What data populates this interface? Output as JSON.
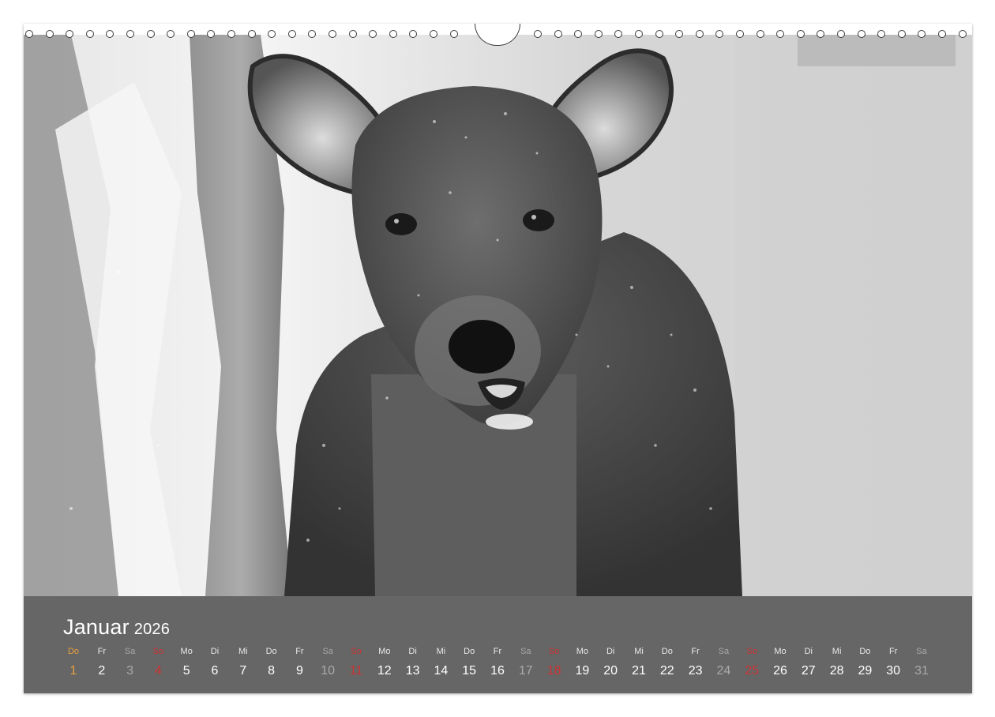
{
  "calendar": {
    "month": "Januar",
    "year": "2026",
    "days": [
      {
        "dow": "Do",
        "num": "1",
        "kind": "holiday"
      },
      {
        "dow": "Fr",
        "num": "2",
        "kind": "weekday"
      },
      {
        "dow": "Sa",
        "num": "3",
        "kind": "sat"
      },
      {
        "dow": "So",
        "num": "4",
        "kind": "sun"
      },
      {
        "dow": "Mo",
        "num": "5",
        "kind": "weekday"
      },
      {
        "dow": "Di",
        "num": "6",
        "kind": "weekday"
      },
      {
        "dow": "Mi",
        "num": "7",
        "kind": "weekday"
      },
      {
        "dow": "Do",
        "num": "8",
        "kind": "weekday"
      },
      {
        "dow": "Fr",
        "num": "9",
        "kind": "weekday"
      },
      {
        "dow": "Sa",
        "num": "10",
        "kind": "sat"
      },
      {
        "dow": "So",
        "num": "11",
        "kind": "sun"
      },
      {
        "dow": "Mo",
        "num": "12",
        "kind": "weekday"
      },
      {
        "dow": "Di",
        "num": "13",
        "kind": "weekday"
      },
      {
        "dow": "Mi",
        "num": "14",
        "kind": "weekday"
      },
      {
        "dow": "Do",
        "num": "15",
        "kind": "weekday"
      },
      {
        "dow": "Fr",
        "num": "16",
        "kind": "weekday"
      },
      {
        "dow": "Sa",
        "num": "17",
        "kind": "sat"
      },
      {
        "dow": "So",
        "num": "18",
        "kind": "sun"
      },
      {
        "dow": "Mo",
        "num": "19",
        "kind": "weekday"
      },
      {
        "dow": "Di",
        "num": "20",
        "kind": "weekday"
      },
      {
        "dow": "Mi",
        "num": "21",
        "kind": "weekday"
      },
      {
        "dow": "Do",
        "num": "22",
        "kind": "weekday"
      },
      {
        "dow": "Fr",
        "num": "23",
        "kind": "weekday"
      },
      {
        "dow": "Sa",
        "num": "24",
        "kind": "sat"
      },
      {
        "dow": "So",
        "num": "25",
        "kind": "sun"
      },
      {
        "dow": "Mo",
        "num": "26",
        "kind": "weekday"
      },
      {
        "dow": "Di",
        "num": "27",
        "kind": "weekday"
      },
      {
        "dow": "Mi",
        "num": "28",
        "kind": "weekday"
      },
      {
        "dow": "Do",
        "num": "29",
        "kind": "weekday"
      },
      {
        "dow": "Fr",
        "num": "30",
        "kind": "weekday"
      },
      {
        "dow": "Sa",
        "num": "31",
        "kind": "sat"
      }
    ]
  },
  "colors": {
    "calendar_bar": "#666666",
    "sunday": "#cc3232",
    "saturday": "#a9a9a9",
    "holiday": "#e6a23c",
    "text": "#ffffff"
  },
  "photo": {
    "subject_icon": "deer-photo"
  }
}
